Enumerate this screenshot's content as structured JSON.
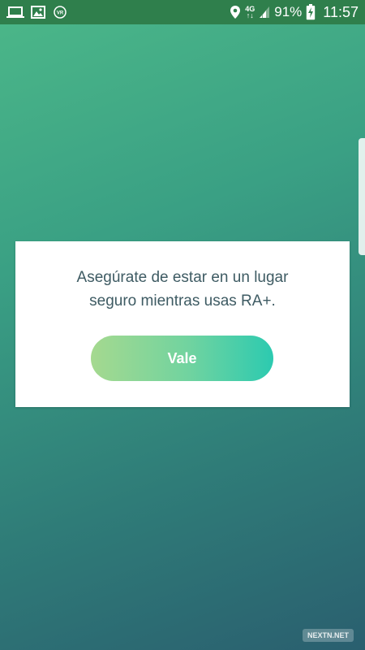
{
  "status_bar": {
    "left_icons": [
      "laptop-icon",
      "image-icon",
      "vr-icon"
    ],
    "vr_label": "VR",
    "network_label_top": "4G",
    "network_label_bottom": "↑↓",
    "battery_percent": "91%",
    "time": "11:57"
  },
  "dialog": {
    "message_line1": "Asegúrate de estar en un lugar",
    "message_line2": "seguro mientras usas RA+.",
    "confirm_label": "Vale"
  },
  "watermark": "NEXTN.NET",
  "colors": {
    "status_bar": "#2f7f4c",
    "gradient_start": "#4cb889",
    "gradient_end": "#2a5f6f",
    "message_text": "#3e5b63",
    "button_start": "#a5d98f",
    "button_end": "#2ccab0"
  }
}
